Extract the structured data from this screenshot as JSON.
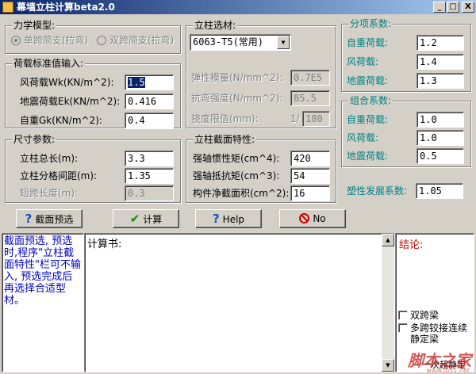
{
  "window": {
    "title": "幕墙立柱计算beta2.0",
    "min_label": "_",
    "max_label": "□",
    "close_label": "X"
  },
  "model": {
    "title": "力学模型:",
    "option1": "单跨简支(拉弯)",
    "option2": "双跨简支(拉弯)"
  },
  "loads": {
    "title": "荷载标准值输入:",
    "wind_label": "风荷载Wk(KN/m^2):",
    "wind_value": "1.5",
    "quake_label": "地震荷载Ek(KN/m^2):",
    "quake_value": "0.416",
    "dead_label": "自重Gk(KN/m^2):",
    "dead_value": "0.4"
  },
  "size": {
    "title": "尺寸参数:",
    "length_label": "立柱总长(m):",
    "length_value": "3.3",
    "spacing_label": "立柱分格间距(m):",
    "spacing_value": "1.35",
    "short_label": "短跨长度(m):",
    "short_value": "0.3"
  },
  "material": {
    "title": "立柱选材:",
    "selected": "6063-T5(常用)",
    "elastic_label": "弹性模量(N/mm^2):",
    "elastic_value": "0.7E5",
    "strength_label": "抗弯强度(N/mm^2):",
    "strength_value": "85.5",
    "deflection_label": "挠度限值(mm):",
    "deflection_prefix": "1/",
    "deflection_value": "180"
  },
  "section": {
    "title": "立柱截面特性:",
    "inertia_label": "强轴惯性矩(cm^4):",
    "inertia_value": "420",
    "modulus_label": "强轴抵抗矩(cm^3):",
    "modulus_value": "54",
    "area_label": "构件净截面积(cm^2):",
    "area_value": "16"
  },
  "partial": {
    "title": "分项系数:",
    "dead_label": "自重荷载:",
    "dead_value": "1.2",
    "wind_label": "风荷载:",
    "wind_value": "1.4",
    "quake_label": "地震荷载:",
    "quake_value": "1.3"
  },
  "combo": {
    "title": "组合系数:",
    "dead_label": "自重荷载:",
    "dead_value": "1.0",
    "wind_label": "风荷载:",
    "wind_value": "1.0",
    "quake_label": "地震荷载:",
    "quake_value": "0.5"
  },
  "plastic": {
    "label": "塑性发展系数:",
    "value": "1.05"
  },
  "buttons": {
    "preselect": "截面预选",
    "calc": "计算",
    "help": "Help",
    "no": "No"
  },
  "notes": {
    "text": "截面预选, 预选时,程序\"立柱截面特性\"栏可不输入, 预选完成后再选择合适型材。"
  },
  "calc_panel": {
    "title": "计算书:"
  },
  "conclusion": {
    "title": "结论:",
    "check1": "双跨梁",
    "check2": "多跨铰接连续",
    "check2_line2": "静定梁",
    "check3_partial": "一次超静定",
    "watermark": "脚本之家",
    "watermark_url": "www.jb51.net"
  }
}
